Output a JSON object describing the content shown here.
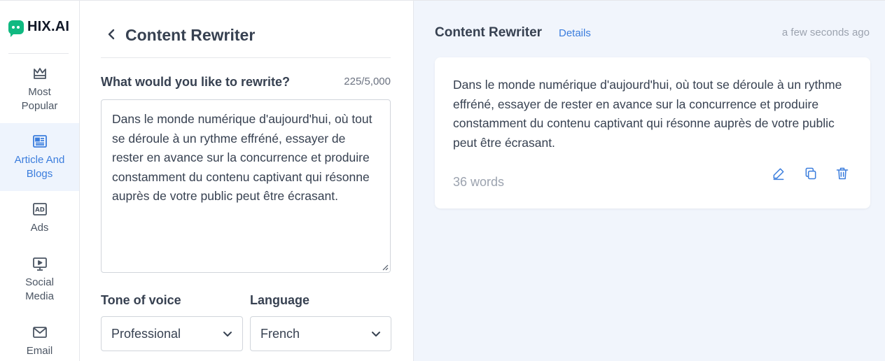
{
  "brand": {
    "name": "HIX.AI",
    "accent": "#10b981"
  },
  "sidebar": {
    "items": [
      {
        "label": "Most\nPopular",
        "icon": "crown-icon"
      },
      {
        "label": "Article And\nBlogs",
        "icon": "newspaper-icon",
        "active": true
      },
      {
        "label": "Ads",
        "icon": "ad-icon"
      },
      {
        "label": "Social\nMedia",
        "icon": "presentation-icon"
      },
      {
        "label": "Email",
        "icon": "mail-icon"
      }
    ]
  },
  "tool": {
    "title": "Content Rewriter",
    "input_label": "What would you like to rewrite?",
    "char_count": "225/5,000",
    "input_text": "Dans le monde numérique d'aujourd'hui, où tout se déroule à un rythme effréné, essayer de rester en avance sur la concurrence et produire constamment du contenu captivant qui résonne auprès de votre public peut être écrasant.",
    "tone_label": "Tone of voice",
    "tone_value": "Professional",
    "language_label": "Language",
    "language_value": "French"
  },
  "result": {
    "title": "Content Rewriter",
    "details_link": "Details",
    "timestamp": "a few seconds ago",
    "text": "Dans le monde numérique d'aujourd'hui, où tout se déroule à un rythme effréné, essayer de rester en avance sur la concurrence et produire constamment du contenu captivant qui résonne auprès de votre public peut être écrasant.",
    "word_count": "36 words",
    "actions": [
      "edit-icon",
      "copy-icon",
      "trash-icon"
    ]
  },
  "colors": {
    "link": "#3b7ddd",
    "active_bg": "#eef4fd",
    "panel_bg": "#f1f5fc"
  }
}
